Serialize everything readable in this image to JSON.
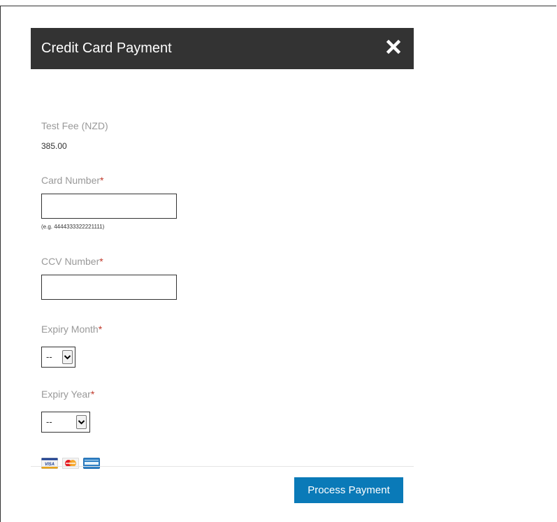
{
  "modal": {
    "title": "Credit Card Payment",
    "close_icon": "close-x-icon"
  },
  "fee": {
    "label": "Test Fee (NZD)",
    "value": "385.00"
  },
  "card_number": {
    "label": "Card Number",
    "required_mark": "*",
    "value": "",
    "hint": "(e.g. 4444333322221111)"
  },
  "ccv_number": {
    "label": "CCV Number",
    "required_mark": "*",
    "value": ""
  },
  "expiry_month": {
    "label": "Expiry Month",
    "required_mark": "*",
    "selected": "--"
  },
  "expiry_year": {
    "label": "Expiry Year",
    "required_mark": "*",
    "selected": "--"
  },
  "card_logos": [
    {
      "icon": "visa-card-icon",
      "text": "VISA"
    },
    {
      "icon": "mastercard-icon"
    },
    {
      "icon": "american-express-icon"
    }
  ],
  "footer": {
    "process_label": "Process Payment"
  },
  "colors": {
    "header_bg": "#333333",
    "button_bg": "#0a7ab8",
    "label": "#999999",
    "required": "#c0392b"
  }
}
